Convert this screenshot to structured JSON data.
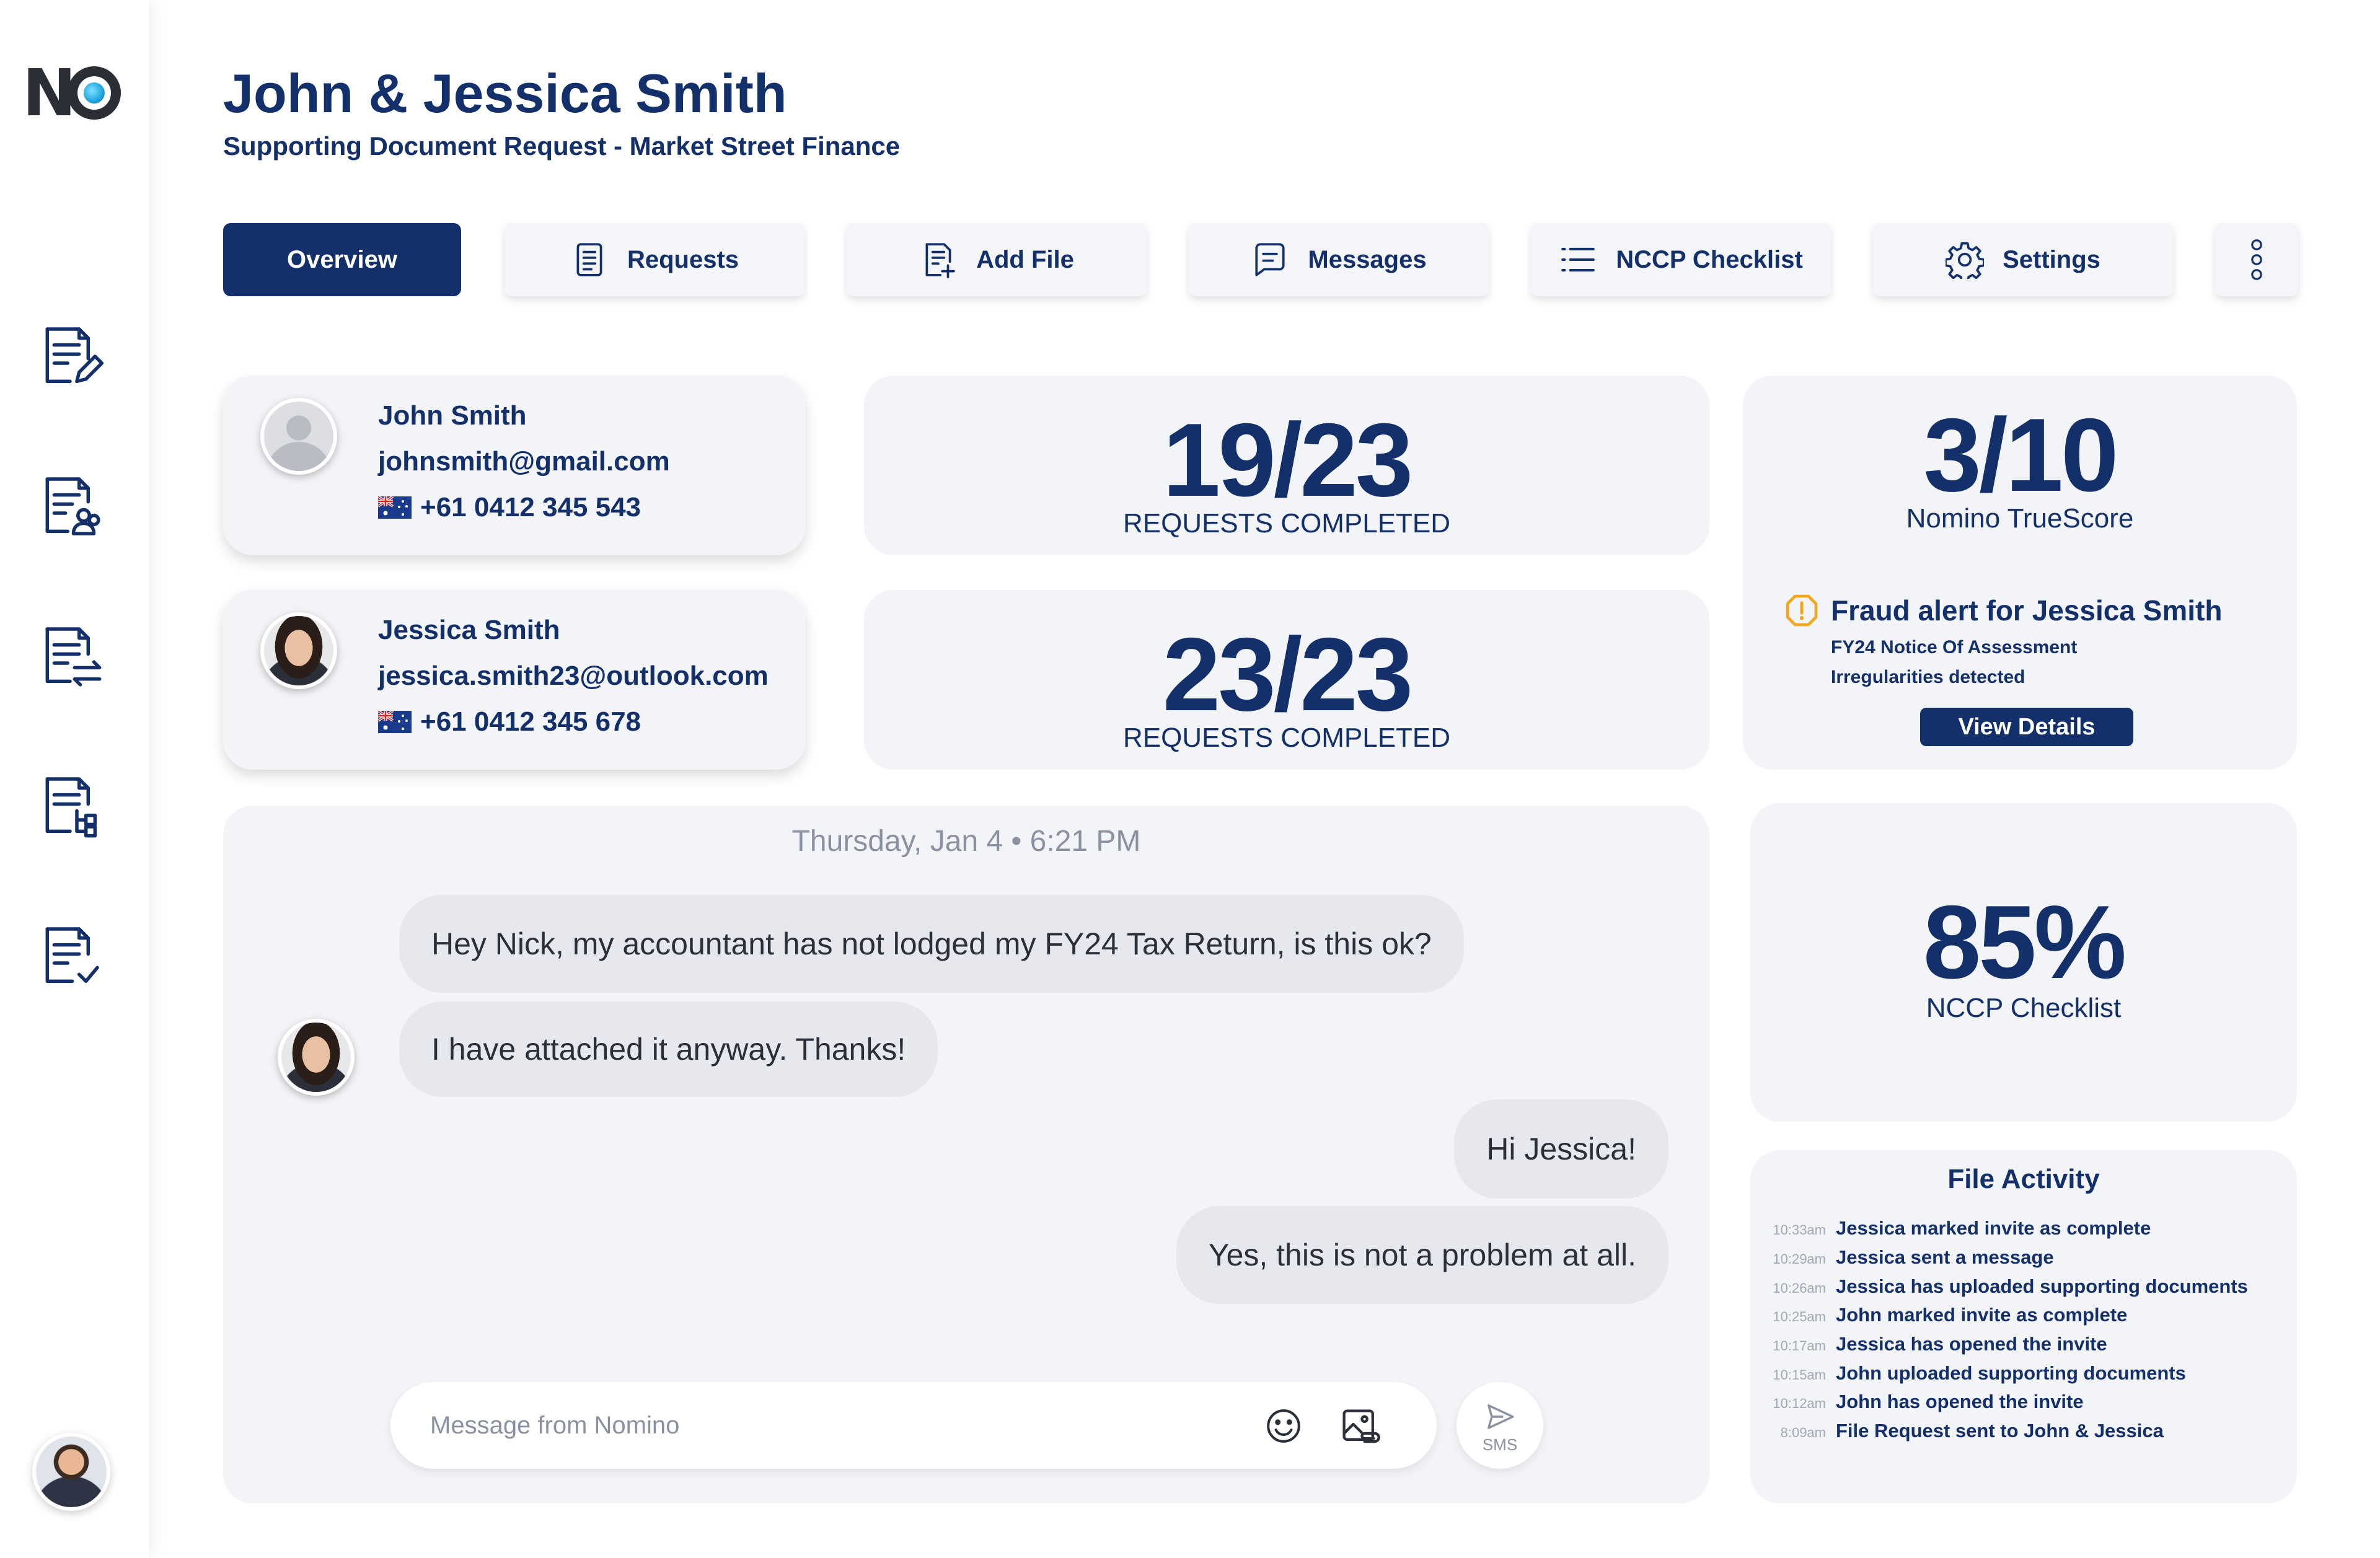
{
  "header": {
    "title": "John & Jessica Smith",
    "subtitle": "Supporting Document Request - Market Street Finance"
  },
  "tabs": [
    {
      "label": "Overview",
      "icon": "none",
      "active": true
    },
    {
      "label": "Requests",
      "icon": "document-icon"
    },
    {
      "label": "Add File",
      "icon": "add-file-icon"
    },
    {
      "label": "Messages",
      "icon": "message-icon"
    },
    {
      "label": "NCCP Checklist",
      "icon": "list-icon"
    },
    {
      "label": "Settings",
      "icon": "gear-icon"
    },
    {
      "label": "",
      "icon": "more-vertical-icon"
    }
  ],
  "contacts": [
    {
      "name": "John Smith",
      "email": "johnsmith@gmail.com",
      "phone": "+61  0412 345 543",
      "avatar": "generic-avatar"
    },
    {
      "name": "Jessica Smith",
      "email": "jessica.smith23@outlook.com",
      "phone": "+61  0412 345 678",
      "avatar": "woman-avatar"
    }
  ],
  "stats": [
    {
      "value": "19/23",
      "label": "REQUESTS COMPLETED"
    },
    {
      "value": "23/23",
      "label": "REQUESTS COMPLETED"
    }
  ],
  "truescore": {
    "value": "3/10",
    "label": "Nomino TrueScore",
    "alert_title": "Fraud alert for Jessica Smith",
    "alert_line1": "FY24 Notice Of Assessment",
    "alert_line2": "Irregularities detected",
    "button": "View Details"
  },
  "nccp": {
    "value": "85%",
    "label": "NCCP Checklist"
  },
  "chat": {
    "date": "Thursday, Jan 4  •  6:21 PM",
    "messages": [
      {
        "from": "Jessica",
        "text": "Hey Nick, my accountant has not lodged my FY24 Tax Return, is this ok?"
      },
      {
        "from": "Jessica",
        "text": "I have attached it anyway. Thanks!"
      },
      {
        "from": "Nick",
        "text": "Hi Jessica!"
      },
      {
        "from": "Nick",
        "text": "Yes, this is not a problem at all."
      }
    ],
    "input_placeholder": "Message from Nomino",
    "send_label": "SMS"
  },
  "file_activity": {
    "title": "File Activity",
    "items": [
      {
        "time": "10:33am",
        "text": "Jessica marked invite as complete"
      },
      {
        "time": "10:29am",
        "text": "Jessica sent a message"
      },
      {
        "time": "10:26am",
        "text": "Jessica has uploaded supporting documents"
      },
      {
        "time": "10:25am",
        "text": "John marked invite as complete"
      },
      {
        "time": "10:17am",
        "text": "Jessica has opened the invite"
      },
      {
        "time": "10:15am",
        "text": "John uploaded supporting documents"
      },
      {
        "time": "10:12am",
        "text": "John has opened the invite"
      },
      {
        "time": "8:09am",
        "text": "File Request sent to John & Jessica"
      }
    ]
  },
  "sidebar": {
    "icons": [
      "edit-document-icon",
      "document-users-icon",
      "document-transfer-icon",
      "document-hierarchy-icon",
      "document-check-icon"
    ]
  },
  "colors": {
    "accent": "#13306b",
    "card": "#f3f4f7",
    "alert": "#f0a820"
  }
}
